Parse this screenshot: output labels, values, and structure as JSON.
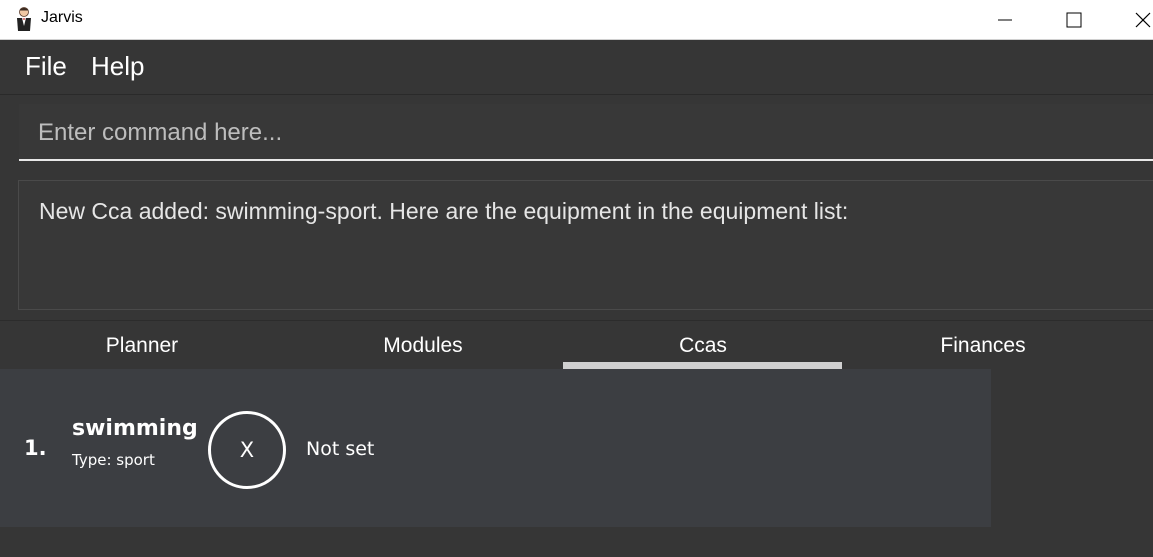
{
  "window": {
    "title": "Jarvis",
    "icon": "butler-icon",
    "controls": [
      "minimize-icon",
      "maximize-icon",
      "close-icon"
    ]
  },
  "menu": {
    "items": [
      {
        "label": "File"
      },
      {
        "label": "Help"
      }
    ]
  },
  "command": {
    "placeholder": "Enter command here...",
    "value": ""
  },
  "result": {
    "message": "New Cca added: swimming-sport. Here are the equipment in the equipment list:"
  },
  "tabs": [
    {
      "label": "Planner",
      "selected": false
    },
    {
      "label": "Modules",
      "selected": false
    },
    {
      "label": "Ccas",
      "selected": true
    },
    {
      "label": "Finances",
      "selected": false
    }
  ],
  "ccas": [
    {
      "index": "1.",
      "name": "swimming",
      "type": "Type: sport",
      "progress_symbol": "X",
      "status": "Not set"
    }
  ],
  "colors": {
    "background": "#363636",
    "panel": "#3c3e42",
    "text": "#ffffff",
    "tab_indicator": "#d0d0d0"
  }
}
